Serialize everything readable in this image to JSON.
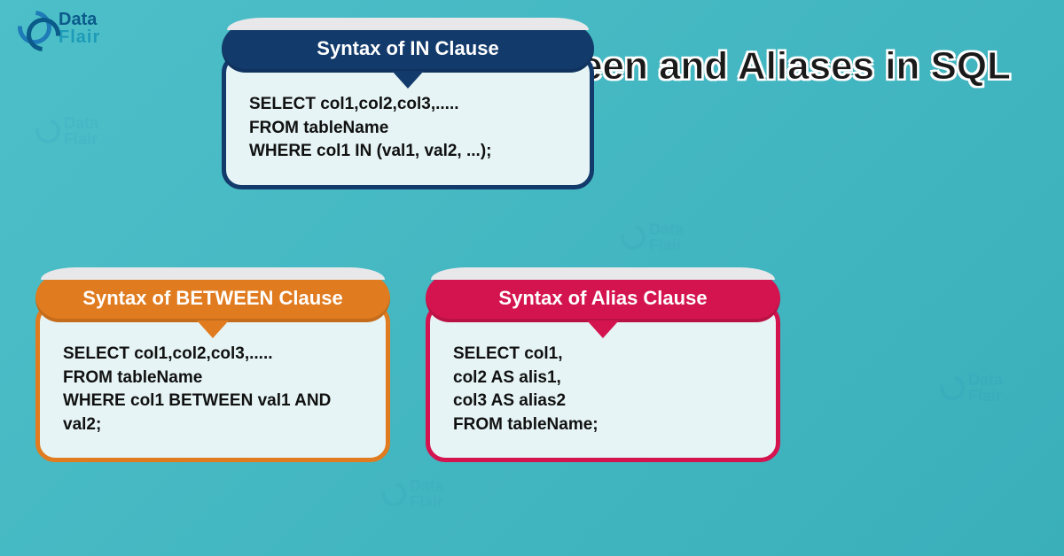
{
  "logo": {
    "line1": "Data",
    "line2": "Flair"
  },
  "title": "In, Between\nand Aliases\nin SQL",
  "cards": [
    {
      "header": "Syntax of IN Clause",
      "body": "SELECT col1,col2,col3,.....\nFROM tableName\nWHERE col1 IN (val1, val2, ...);"
    },
    {
      "header": "Syntax of BETWEEN Clause",
      "body": "SELECT  col1,col2,col3,.....\nFROM tableName\nWHERE col1 BETWEEN val1 AND val2;"
    },
    {
      "header": "Syntax of Alias Clause",
      "body": "SELECT col1,\ncol2 AS alis1,\ncol3 AS alias2\nFROM tableName;"
    }
  ],
  "watermark": {
    "line1": "Data",
    "line2": "Flair"
  }
}
